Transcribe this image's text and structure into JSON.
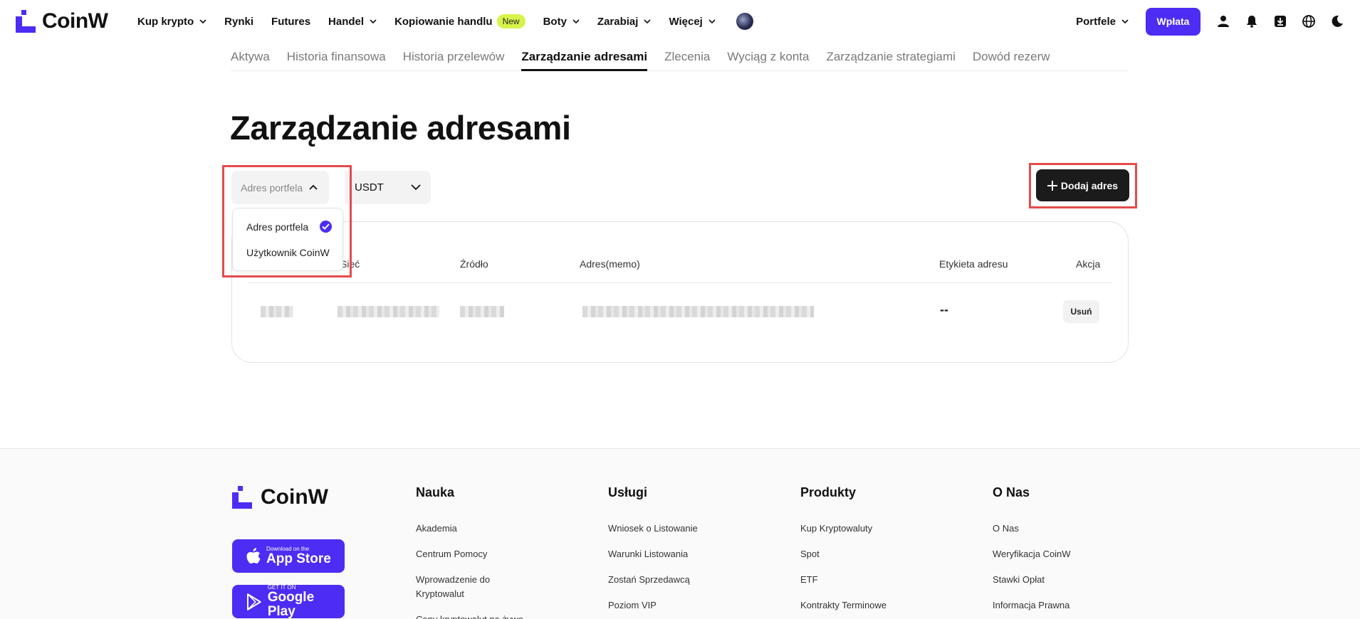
{
  "brand": {
    "name": "CoinW",
    "accent": "#4d2cf4"
  },
  "header": {
    "nav": [
      {
        "label": "Kup krypto",
        "dropdown": true
      },
      {
        "label": "Rynki",
        "dropdown": false
      },
      {
        "label": "Futures",
        "dropdown": false
      },
      {
        "label": "Handel",
        "dropdown": true
      },
      {
        "label": "Kopiowanie handlu",
        "dropdown": false,
        "badge": "New"
      },
      {
        "label": "Boty",
        "dropdown": true
      },
      {
        "label": "Zarabiaj",
        "dropdown": true
      },
      {
        "label": "Więcej",
        "dropdown": true
      }
    ],
    "wallets_label": "Portfele",
    "deposit_label": "Wpłata",
    "icons": [
      "user-icon",
      "bell-icon",
      "download-icon",
      "globe-icon",
      "moon-icon"
    ]
  },
  "subnav": {
    "tabs": [
      "Aktywa",
      "Historia finansowa",
      "Historia przelewów",
      "Zarządzanie adresami",
      "Zlecenia",
      "Wyciąg z konta",
      "Zarządzanie strategiami",
      "Dowód rezerw"
    ],
    "active_index": 3
  },
  "page": {
    "title": "Zarządzanie adresami",
    "type_filter": {
      "value": "Adres portfela",
      "options": [
        "Adres portfela",
        "Użytkownik CoinW"
      ],
      "selected_index": 0
    },
    "coin_filter": {
      "value": "USDT"
    },
    "add_button": "Dodaj adres"
  },
  "table": {
    "columns": [
      "Sieć",
      "Źródło",
      "Adres(memo)",
      "Etykieta adresu",
      "Akcja"
    ],
    "row": {
      "label": "--",
      "action": "Usuń"
    }
  },
  "footer": {
    "brand": "CoinW",
    "app_store": {
      "small": "Download on the",
      "big": "App Store"
    },
    "google_play": {
      "small": "GET IT ON",
      "big": "Google Play"
    },
    "columns": [
      {
        "title": "Nauka",
        "links": [
          "Akademia",
          "Centrum Pomocy",
          "Wprowadzenie do Kryptowalut",
          "Ceny kryptowalut na żywo"
        ]
      },
      {
        "title": "Usługi",
        "links": [
          "Wniosek o Listowanie",
          "Warunki Listowania",
          "Zostań Sprzedawcą",
          "Poziom VIP"
        ]
      },
      {
        "title": "Produkty",
        "links": [
          "Kup Kryptowaluty",
          "Spot",
          "ETF",
          "Kontrakty Terminowe"
        ]
      },
      {
        "title": "O Nas",
        "links": [
          "O Nas",
          "Weryfikacja CoinW",
          "Stawki Opłat",
          "Informacja Prawna"
        ]
      }
    ]
  }
}
